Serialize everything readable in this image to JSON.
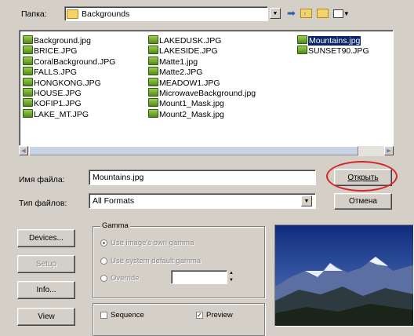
{
  "lookin": {
    "label": "Папка:",
    "folder": "Backgrounds"
  },
  "files": {
    "column1": [
      "Background.jpg",
      "BRICE.JPG",
      "CoralBackground.JPG",
      "FALLS.JPG",
      "HONGKONG.JPG",
      "HOUSE.JPG",
      "KOFIP1.JPG",
      "LAKE_MT.JPG"
    ],
    "column2": [
      "LAKEDUSK.JPG",
      "LAKESIDE.JPG",
      "Matte1.jpg",
      "Matte2.JPG",
      "MEADOW1.JPG",
      "MicrowaveBackground.jpg",
      "Mount1_Mask.jpg",
      "Mount2_Mask.jpg"
    ],
    "column3": [
      "Mountains.jpg",
      "SUNSET90.JPG"
    ],
    "selected": "Mountains.jpg"
  },
  "filename": {
    "label": "Имя файла:",
    "value": "Mountains.jpg"
  },
  "filetype": {
    "label": "Тип файлов:",
    "value": "All Formats"
  },
  "buttons": {
    "open": "Открыть",
    "cancel": "Отмена",
    "devices": "Devices...",
    "setup": "Setup",
    "info": "Info...",
    "view": "View"
  },
  "gamma": {
    "title": "Gamma",
    "option1": "Use image's own gamma",
    "option2": "Use system default gamma",
    "option3": "Override"
  },
  "options": {
    "sequence": "Sequence",
    "preview": "Preview"
  },
  "colors": {
    "dialog_bg": "#d4d0c8",
    "selection": "#0a246a",
    "highlight_circle": "#d9252a"
  }
}
